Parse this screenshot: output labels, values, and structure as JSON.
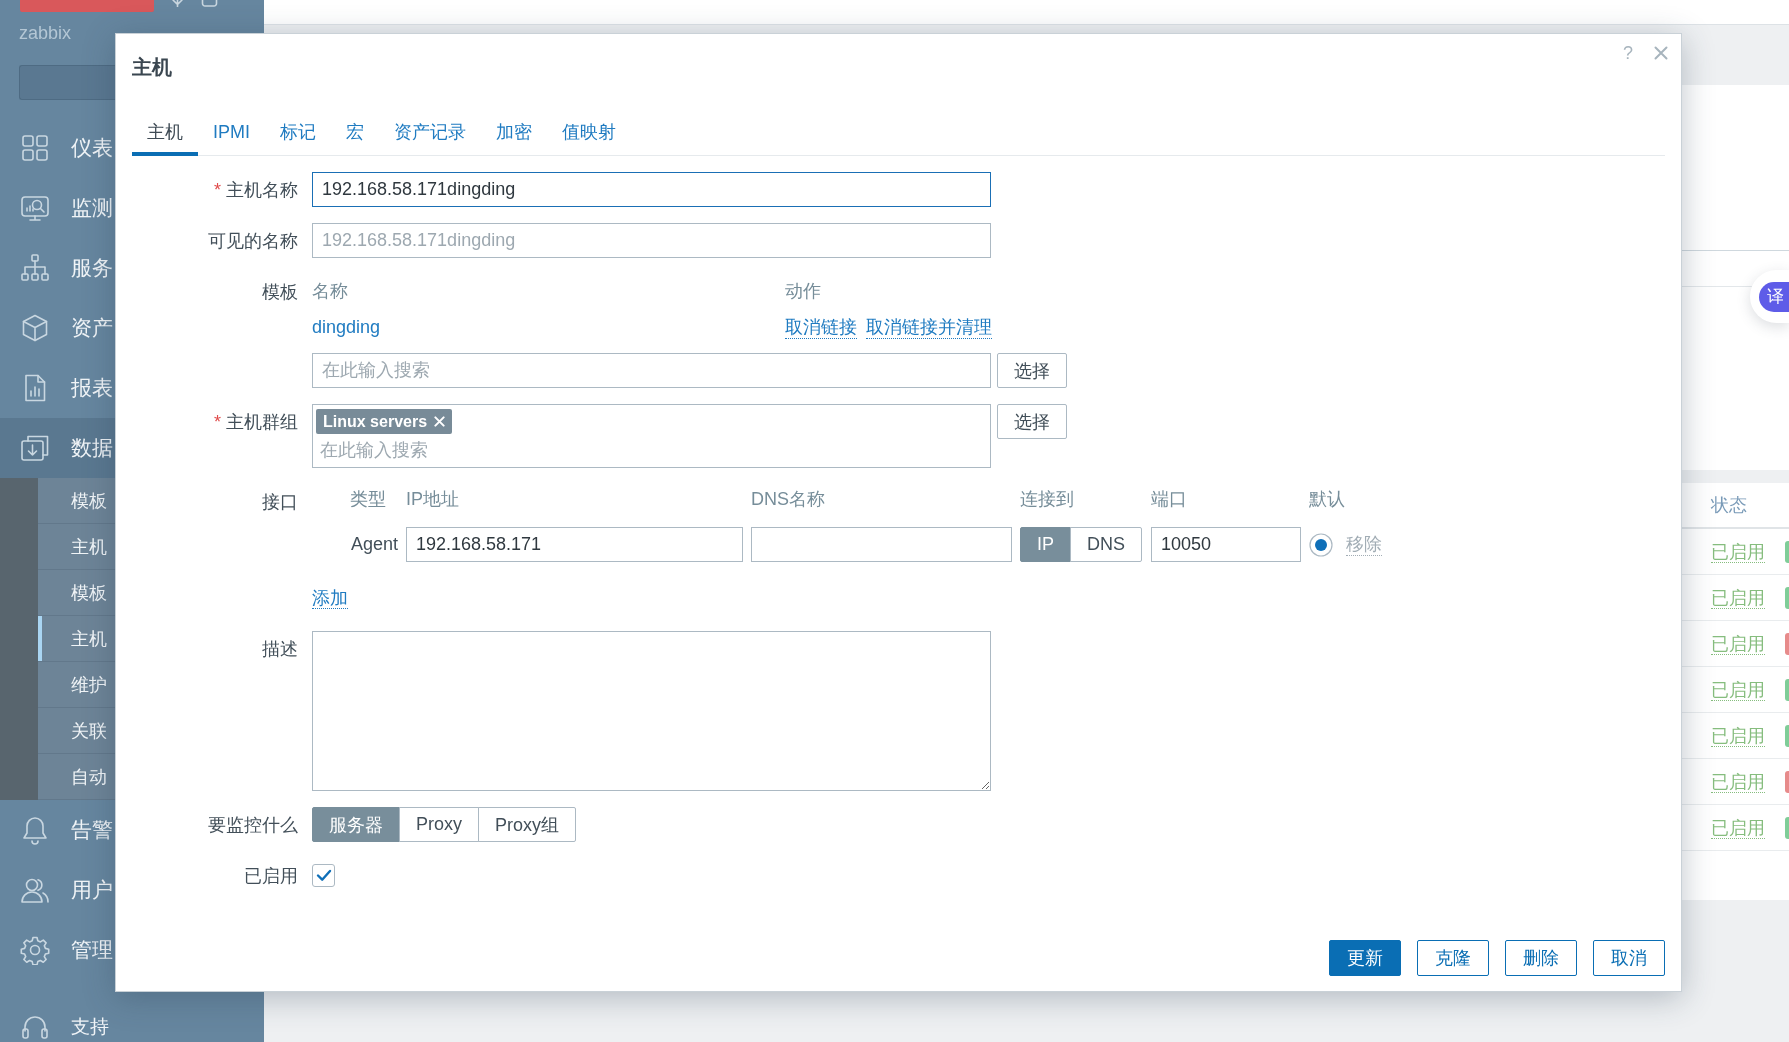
{
  "sidebar": {
    "server_name": "zabbix",
    "menu": [
      {
        "label": "仪表",
        "expanded": false
      },
      {
        "label": "监测",
        "expanded": false
      },
      {
        "label": "服务",
        "expanded": false
      },
      {
        "label": "资产",
        "expanded": false
      },
      {
        "label": "报表",
        "expanded": false
      },
      {
        "label": "数据",
        "expanded": true,
        "children": [
          {
            "label": "模板",
            "selected": false
          },
          {
            "label": "主机",
            "selected": false
          },
          {
            "label": "模板",
            "selected": false
          },
          {
            "label": "主机",
            "selected": true
          },
          {
            "label": "维护",
            "selected": false
          },
          {
            "label": "关联",
            "selected": false
          },
          {
            "label": "自动",
            "selected": false
          }
        ]
      },
      {
        "label": "告警",
        "expanded": false
      },
      {
        "label": "用户",
        "expanded": false
      },
      {
        "label": "管理",
        "expanded": false
      }
    ],
    "support": "支持"
  },
  "dialog": {
    "title": "主机",
    "help": "?",
    "tabs": [
      {
        "label": "主机",
        "selected": true
      },
      {
        "label": "IPMI",
        "selected": false
      },
      {
        "label": "标记",
        "selected": false
      },
      {
        "label": "宏",
        "selected": false
      },
      {
        "label": "资产记录",
        "selected": false
      },
      {
        "label": "加密",
        "selected": false
      },
      {
        "label": "值映射",
        "selected": false
      }
    ],
    "form": {
      "host_name": {
        "label": "主机名称",
        "required_mark": "*",
        "value": "192.168.58.171dingding",
        "focused": true
      },
      "visible_name": {
        "label": "可见的名称",
        "placeholder": "192.168.58.171dingding",
        "focused": false
      },
      "templates": {
        "label": "模板",
        "columns": [
          "名称",
          "动作"
        ],
        "linked": [
          {
            "name": "dingding",
            "actions": [
              "取消链接",
              "取消链接并清理"
            ]
          }
        ],
        "search": {
          "placeholder": "在此输入搜索"
        },
        "select_button": "选择"
      },
      "host_groups": {
        "label": "主机群组",
        "required_mark": "*",
        "tags": [
          "Linux servers"
        ],
        "placeholder": "在此输入搜索",
        "select_button": "选择"
      },
      "interfaces": {
        "label": "接口",
        "columns": [
          "类型",
          "IP地址",
          "DNS名称",
          "连接到",
          "端口",
          "默认"
        ],
        "rows": [
          {
            "type": "Agent",
            "ip": "192.168.58.171",
            "connect_to": [
              {
                "label": "IP",
                "selected": true
              },
              {
                "label": "DNS",
                "selected": false
              }
            ],
            "port": "10050",
            "default": true,
            "remove": "移除",
            "remove_disabled": true
          }
        ],
        "add_link": "添加"
      },
      "description": {
        "label": "描述"
      },
      "monitored_by": {
        "label": "要监控什么",
        "options": [
          {
            "label": "服务器",
            "selected": true
          },
          {
            "label": "Proxy",
            "selected": false
          },
          {
            "label": "Proxy组",
            "selected": false
          }
        ]
      },
      "enabled": {
        "label": "已启用",
        "checked": true
      }
    },
    "buttons": [
      {
        "label": "更新",
        "kind": "primary"
      },
      {
        "label": "克隆",
        "kind": "secondary"
      },
      {
        "label": "删除",
        "kind": "secondary"
      },
      {
        "label": "取消",
        "kind": "secondary"
      }
    ]
  },
  "page": {
    "translate_button": "译",
    "table": {
      "columns": [
        "状态"
      ],
      "rows": [
        {
          "status": "已启用",
          "color": "#7fcd98"
        },
        {
          "status": "已启用",
          "color": "#7fcd98"
        },
        {
          "status": "已启用",
          "color": "#e78b8b"
        },
        {
          "status": "已启用",
          "color": "#7fcd98"
        },
        {
          "status": "已启用",
          "color": "#7fcd98"
        },
        {
          "status": "已启用",
          "color": "#e78b8b"
        },
        {
          "status": "已启用",
          "color": "#7fcd98"
        }
      ]
    }
  }
}
